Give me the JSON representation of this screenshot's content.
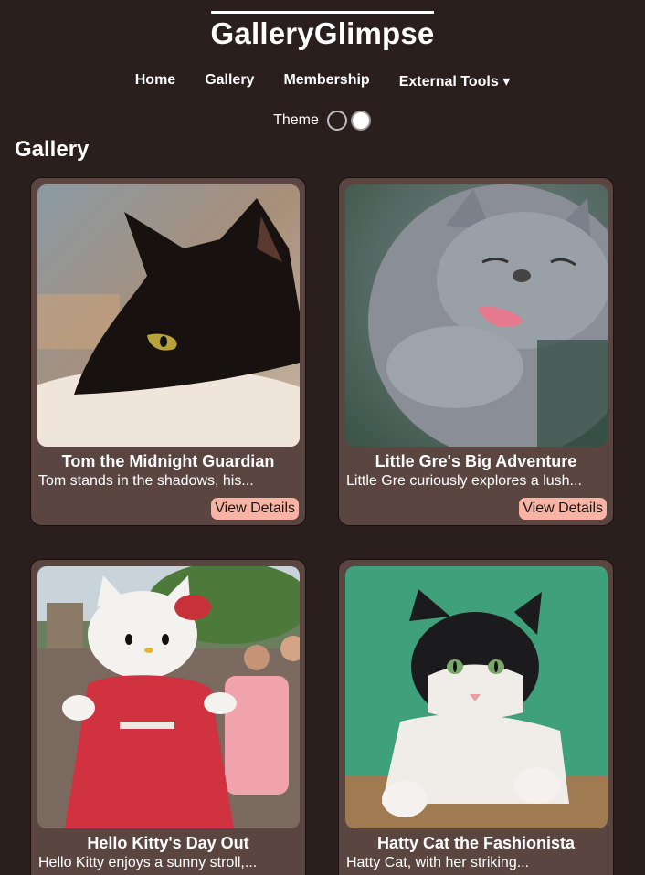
{
  "brand": {
    "name": "GalleryGlimpse"
  },
  "nav": {
    "items": [
      "Home",
      "Gallery",
      "Membership"
    ],
    "external_tools": "External Tools ▾"
  },
  "theme": {
    "label": "Theme",
    "options": [
      "dark",
      "light"
    ],
    "colors": {
      "dark": "#2b1f1d",
      "light": "#ffffff"
    }
  },
  "gallery": {
    "title": "Gallery",
    "button_label": "View Details",
    "cards": [
      {
        "title": "Tom the Midnight Guardian",
        "description": "Tom stands in the shadows, his...",
        "image": "black-cat-photo"
      },
      {
        "title": "Little Gre's Big Adventure",
        "description": "Little Gre curiously explores a lush...",
        "image": "gray-cat-photo"
      },
      {
        "title": "Hello Kitty's Day Out",
        "description": "Hello Kitty enjoys a sunny stroll,...",
        "image": "hello-kitty-parade-photo"
      },
      {
        "title": "Hatty Cat the Fashionista",
        "description": "Hatty Cat, with her striking...",
        "image": "tuxedo-cat-photo"
      }
    ]
  },
  "colors": {
    "background": "#2b1f1d",
    "card": "#5b4540",
    "button": "#f7b4a4"
  }
}
